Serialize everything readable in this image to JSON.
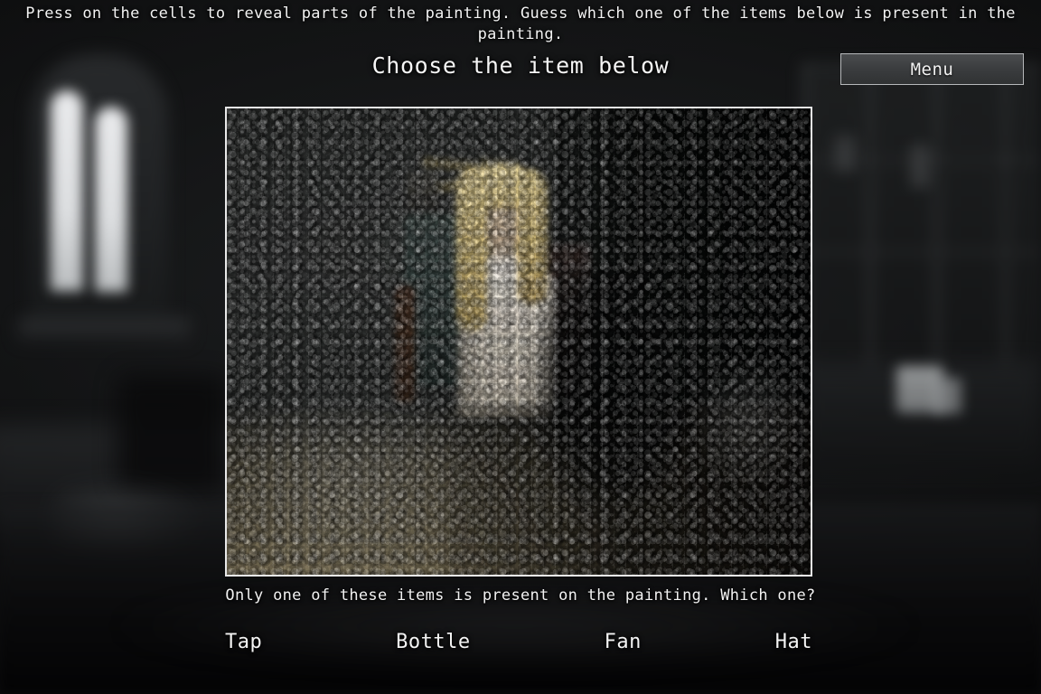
{
  "header": {
    "instructions": "Press on the cells to reveal parts of the painting. Guess which one of the items below is present in the painting.",
    "title": "Choose the item below",
    "menu_label": "Menu"
  },
  "painting": {
    "alt": "obscured-painting-blonde-girl-in-chair",
    "frame_color": "#e8e8e8"
  },
  "footer": {
    "prompt": "Only one of these items is present on the painting. Which one?",
    "options": [
      {
        "label": "Tap"
      },
      {
        "label": "Bottle"
      },
      {
        "label": "Fan"
      },
      {
        "label": "Hat"
      }
    ]
  },
  "colors": {
    "background": "#0b0b0c",
    "text": "#f2f2f2",
    "button_border": "#b6b8ba",
    "button_fill": "#3b3d3f"
  }
}
